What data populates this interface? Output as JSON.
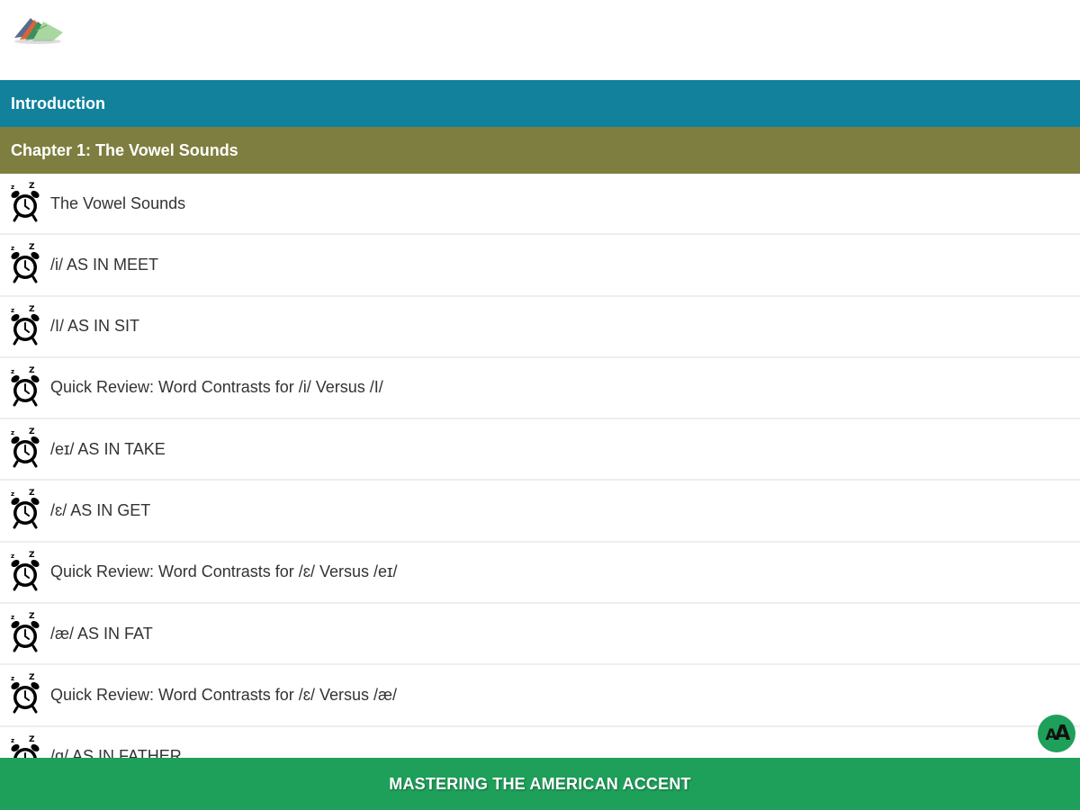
{
  "header": {
    "logo_icon": "book-stack-icon"
  },
  "sections": {
    "introduction": "Introduction",
    "chapter": "Chapter 1: The Vowel Sounds"
  },
  "colors": {
    "introduction_bg": "#11819c",
    "chapter_bg": "#7e7e40",
    "footer_bg": "#1ea05a"
  },
  "list": {
    "item_icon": "alarm-clock-icon",
    "items": [
      {
        "label": "The Vowel Sounds"
      },
      {
        "label": "/i/ AS IN MEET"
      },
      {
        "label": "/I/ AS IN SIT"
      },
      {
        "label": "Quick Review: Word Contrasts for /i/ Versus /I/"
      },
      {
        "label": "/eɪ/ AS IN TAKE"
      },
      {
        "label": "/ɛ/ AS IN GET"
      },
      {
        "label": "Quick Review: Word Contrasts for /ɛ/ Versus /eɪ/"
      },
      {
        "label": "/æ/ AS IN FAT"
      },
      {
        "label": "Quick Review: Word Contrasts for /ɛ/ Versus /æ/"
      },
      {
        "label": "/ɑ/ AS IN FATHER"
      }
    ]
  },
  "font_size_button": {
    "icon": "font-size-icon",
    "small": "A",
    "large": "A"
  },
  "footer": {
    "title": "MASTERING THE AMERICAN ACCENT"
  }
}
